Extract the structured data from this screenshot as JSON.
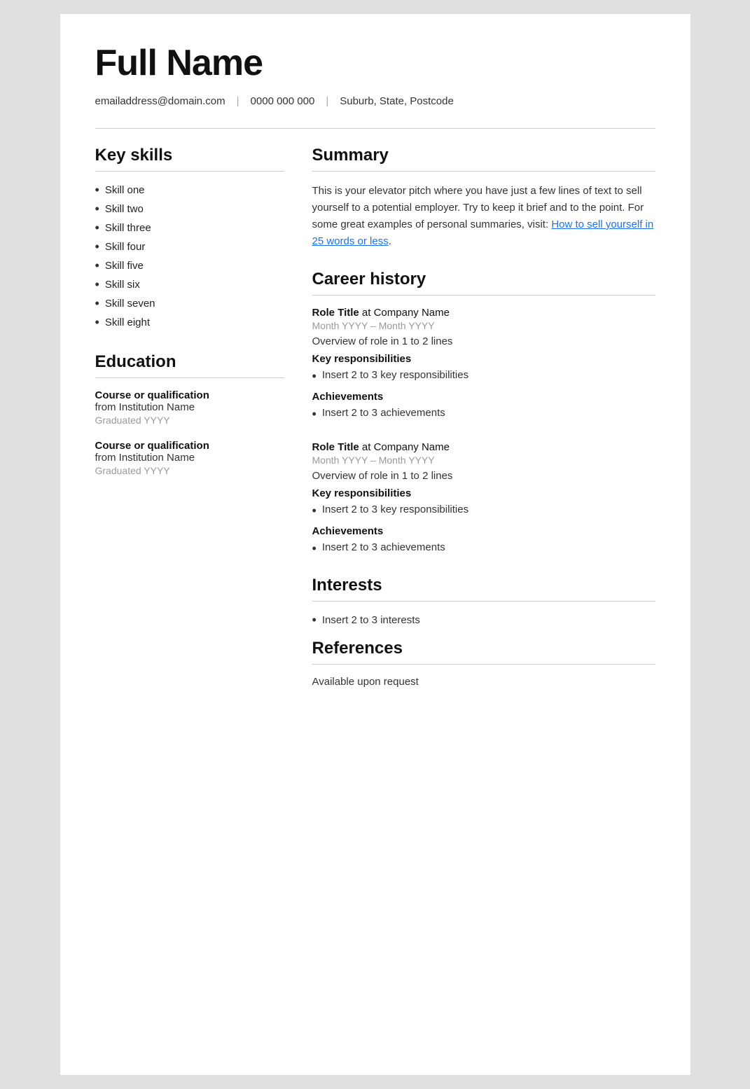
{
  "header": {
    "name": "Full Name",
    "email": "emailaddress@domain.com",
    "phone": "0000 000 000",
    "location": "Suburb, State, Postcode"
  },
  "left": {
    "skills_title": "Key skills",
    "skills": [
      "Skill one",
      "Skill two",
      "Skill three",
      "Skill four",
      "Skill five",
      "Skill six",
      "Skill seven",
      "Skill eight"
    ],
    "education_title": "Education",
    "education": [
      {
        "course": "Course or qualification",
        "institution": "from Institution Name",
        "graduated": "Graduated YYYY"
      },
      {
        "course": "Course or qualification",
        "institution": "from Institution Name",
        "graduated": "Graduated YYYY"
      }
    ]
  },
  "right": {
    "summary_title": "Summary",
    "summary_text": "This is your elevator pitch where you have just a few lines of text to sell yourself to a potential employer. Try to keep it brief and to the point. For some great examples of personal summaries, visit: ",
    "summary_link_text": "How to sell yourself in 25 words or less",
    "summary_link_end": ".",
    "career_title": "Career history",
    "jobs": [
      {
        "role": "Role Title",
        "company": "at Company Name",
        "dates": "Month YYYY – Month YYYY",
        "overview": "Overview of role in 1 to 2 lines",
        "responsibilities_title": "Key responsibilities",
        "responsibilities": [
          "Insert 2 to 3 key responsibilities"
        ],
        "achievements_title": "Achievements",
        "achievements": [
          "Insert 2 to 3 achievements"
        ]
      },
      {
        "role": "Role Title",
        "company": "at Company Name",
        "dates": "Month YYYY – Month YYYY",
        "overview": "Overview of role in 1 to 2 lines",
        "responsibilities_title": "Key responsibilities",
        "responsibilities": [
          "Insert 2 to 3 key responsibilities"
        ],
        "achievements_title": "Achievements",
        "achievements": [
          "Insert 2 to 3 achievements"
        ]
      }
    ],
    "interests_title": "Interests",
    "interests": [
      "Insert 2 to 3 interests"
    ],
    "references_title": "References",
    "references_text": "Available upon request"
  }
}
